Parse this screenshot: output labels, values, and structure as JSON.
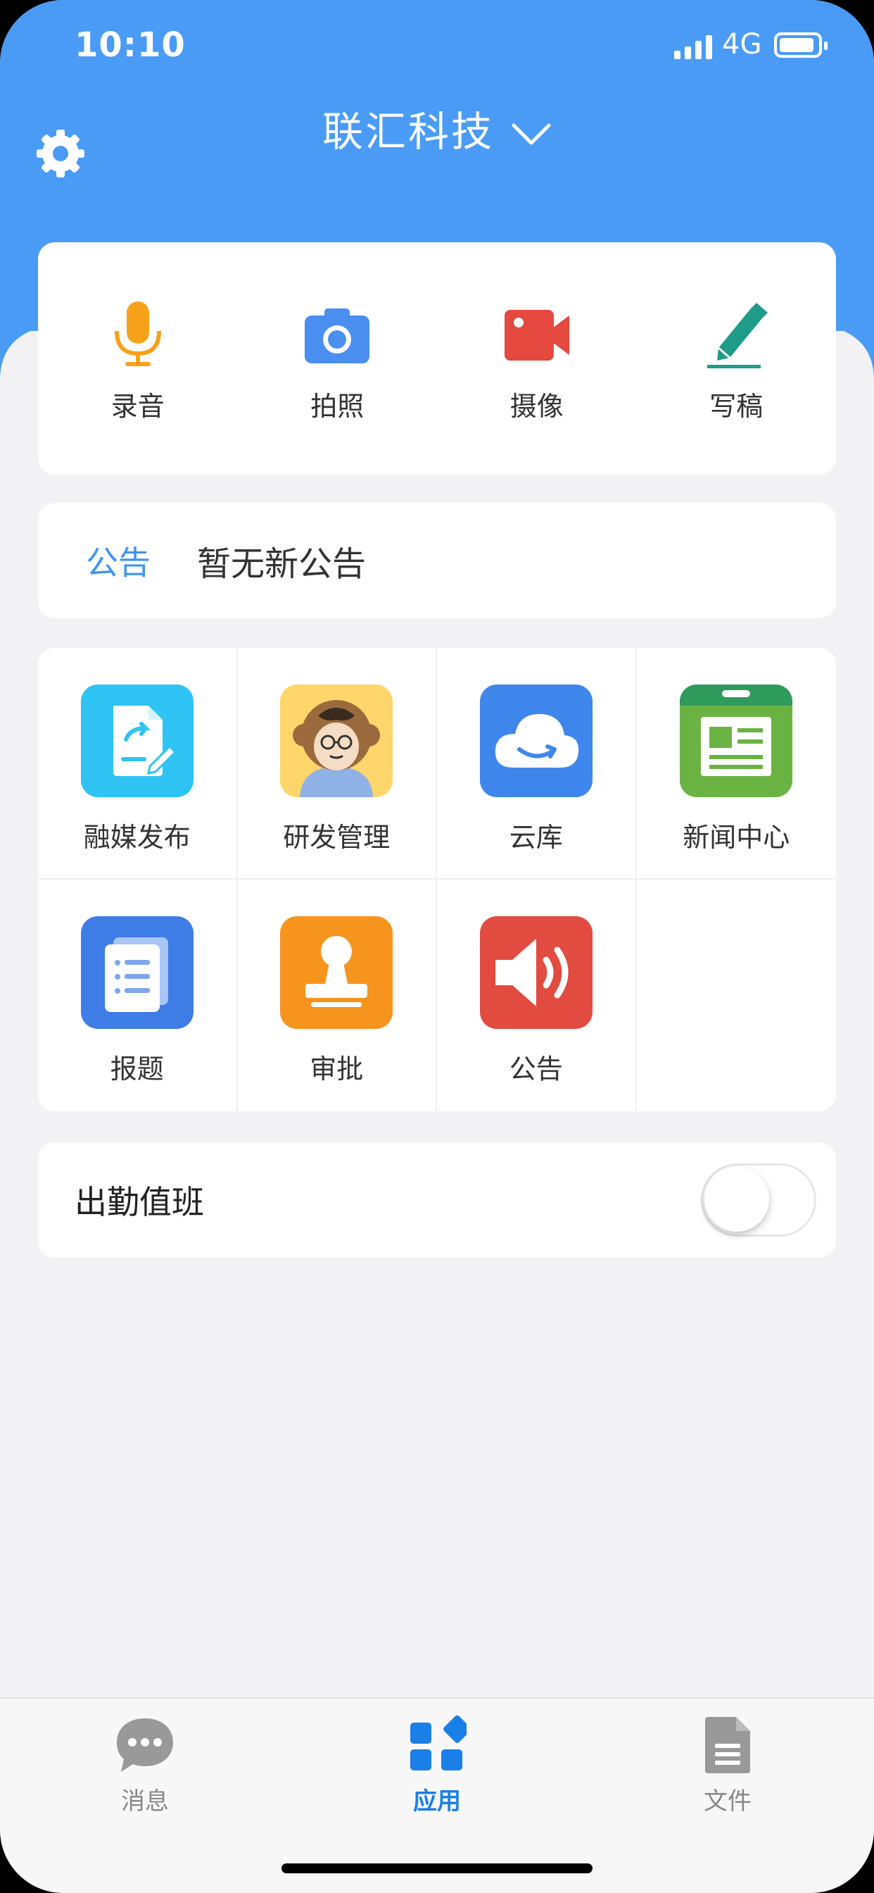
{
  "status_bar": {
    "time": "10:10",
    "network": "4G"
  },
  "header": {
    "title": "联汇科技"
  },
  "quick_actions": [
    {
      "label": "录音",
      "icon": "microphone-icon",
      "color": "#f7a11a"
    },
    {
      "label": "拍照",
      "icon": "camera-icon",
      "color": "#4a8ef0"
    },
    {
      "label": "摄像",
      "icon": "video-camera-icon",
      "color": "#e4483f"
    },
    {
      "label": "写稿",
      "icon": "pencil-icon",
      "color": "#1f9b8a"
    }
  ],
  "notice": {
    "tag": "公告",
    "text": "暂无新公告"
  },
  "apps": [
    {
      "label": "融媒发布",
      "icon": "publish-document-icon"
    },
    {
      "label": "研发管理",
      "icon": "monkey-avatar-icon"
    },
    {
      "label": "云库",
      "icon": "cloud-icon"
    },
    {
      "label": "新闻中心",
      "icon": "newspaper-icon"
    },
    {
      "label": "报题",
      "icon": "report-list-icon"
    },
    {
      "label": "审批",
      "icon": "stamp-icon"
    },
    {
      "label": "公告",
      "icon": "speaker-icon"
    }
  ],
  "duty": {
    "label": "出勤值班",
    "enabled": false
  },
  "tabbar": [
    {
      "label": "消息",
      "icon": "chat-bubble-icon",
      "active": false
    },
    {
      "label": "应用",
      "icon": "apps-grid-icon",
      "active": true
    },
    {
      "label": "文件",
      "icon": "document-icon",
      "active": false
    }
  ],
  "colors": {
    "primary": "#4a9bf5",
    "accent": "#1a7fe6",
    "background": "#f2f2f4"
  }
}
